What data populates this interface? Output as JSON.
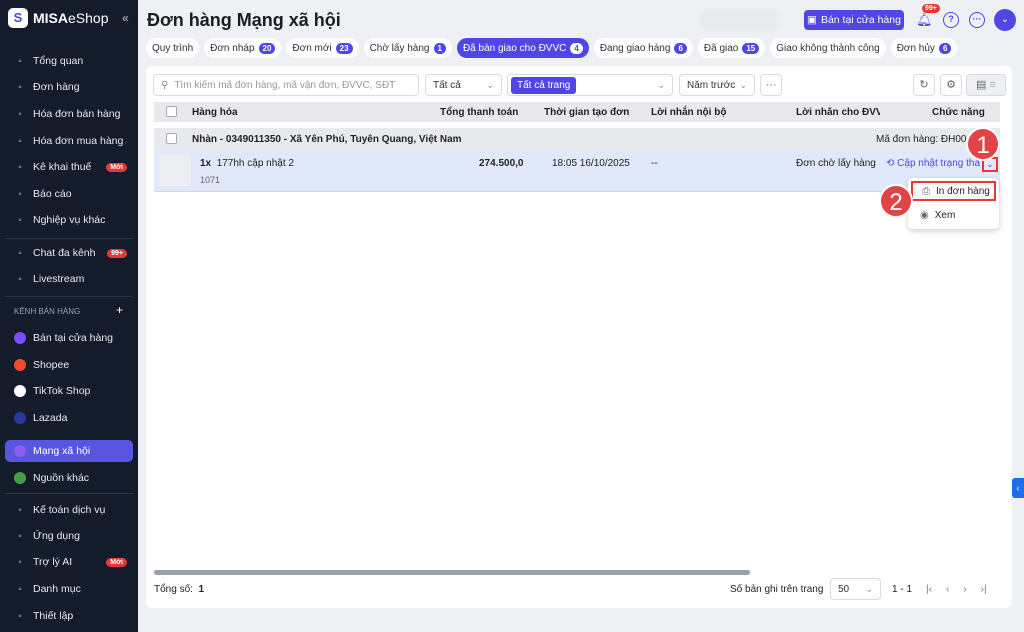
{
  "sidebar": {
    "brand": "MISA",
    "brand2": "eShop",
    "items": [
      {
        "label": "Tổng quan",
        "icon": "gauge-icon"
      },
      {
        "label": "Đơn hàng",
        "icon": "order-icon"
      },
      {
        "label": "Hóa đơn bán hàng",
        "icon": "invoice-icon"
      },
      {
        "label": "Hóa đơn mua hàng",
        "icon": "purchase-invoice-icon"
      },
      {
        "label": "Kê khai thuế",
        "icon": "tax-icon",
        "badge": "Mới"
      },
      {
        "label": "Báo cáo",
        "icon": "chart-icon"
      },
      {
        "label": "Nghiệp vụ khác",
        "icon": "list-icon"
      },
      {
        "label": "Chat đa kênh",
        "icon": "chat-icon",
        "badge": "99+"
      },
      {
        "label": "Livestream",
        "icon": "livestream-icon"
      }
    ],
    "section": "KÊNH BÁN HÀNG",
    "channels": [
      {
        "label": "Bán tại cửa hàng",
        "color": "#7c4dff"
      },
      {
        "label": "Shopee",
        "color": "#ee4d2d"
      },
      {
        "label": "TikTok Shop",
        "color": "#ffffff"
      },
      {
        "label": "Lazada",
        "color": "#2a3a9c"
      },
      {
        "label": "Mạng xã hội",
        "color": "#8b5cf6"
      },
      {
        "label": "Nguồn khác",
        "color": "#43a047"
      }
    ],
    "bottom": [
      {
        "label": "Kế toán dịch vụ",
        "icon": "accounting-icon"
      },
      {
        "label": "Ứng dụng",
        "icon": "apps-icon"
      },
      {
        "label": "Trợ lý AI",
        "icon": "ai-icon",
        "badge": "Mới"
      },
      {
        "label": "Danh mục",
        "icon": "menu-icon"
      },
      {
        "label": "Thiết lập",
        "icon": "gear-icon"
      }
    ]
  },
  "header": {
    "title": "Đơn hàng Mạng xã hội",
    "store_button": "Bán tại cửa hàng",
    "notif_count": "99+"
  },
  "tabs": [
    {
      "label": "Quy trình"
    },
    {
      "label": "Đơn nháp",
      "count": "20"
    },
    {
      "label": "Đơn mới",
      "count": "23"
    },
    {
      "label": "Chờ lấy hàng",
      "count": "1"
    },
    {
      "label": "Đã bàn giao cho ĐVVC",
      "count": "4",
      "active": true
    },
    {
      "label": "Đang giao hàng",
      "count": "6"
    },
    {
      "label": "Đã giao",
      "count": "15"
    },
    {
      "label": "Giao không thành công"
    },
    {
      "label": "Đơn hủy",
      "count": "6"
    }
  ],
  "toolbar": {
    "search_placeholder": "Tìm kiếm mã đơn hàng, mã vận đơn, ĐVVC, SĐT",
    "filter1": "Tất cả",
    "filter2_chip": "Tất cả trang",
    "period": "Năm trước",
    "more": "···"
  },
  "table": {
    "columns": [
      "Hàng hóa",
      "Tổng thanh toán",
      "Thời gian tạo đơn",
      "Lời nhắn nội bộ",
      "Lời nhắn cho ĐVVC",
      "Chức năng"
    ],
    "group": {
      "recipient": "Nhàn - 0349011350 - Xã Yên Phú, Tuyên Quang, Việt Nam",
      "order_code": "Mã đơn hàng: ĐH00"
    },
    "row": {
      "qty": "1x",
      "product": "177hh cập nhật 2",
      "sku": "1071",
      "total": "274.500,0",
      "created": "18:05 16/10/2025",
      "internal_note": "--",
      "carrier_note": "Đơn chờ lấy hàng",
      "action": "Cập nhật trạng thá"
    }
  },
  "dropdown": {
    "items": [
      "In đơn hàng",
      "Xem"
    ]
  },
  "markers": [
    "1",
    "2"
  ],
  "footer": {
    "total_label": "Tổng số:",
    "total": "1",
    "per_page_label": "Số bản ghi trên trang",
    "per_page": "50",
    "range": "1 - 1"
  }
}
